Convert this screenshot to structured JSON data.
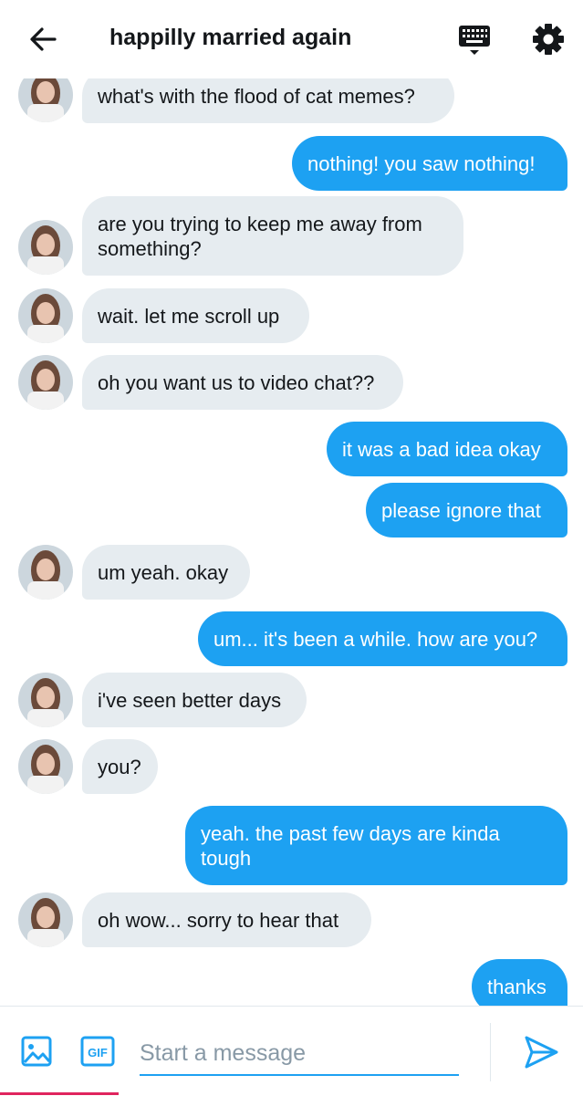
{
  "header": {
    "title": "happilly married again",
    "back_icon": "arrow-left-icon",
    "keyboard_icon": "keyboard-icon",
    "settings_icon": "gear-icon"
  },
  "messages": [
    {
      "from": "them",
      "text": "what's with the flood of cat memes?"
    },
    {
      "from": "me",
      "text": "nothing! you saw nothing!"
    },
    {
      "from": "them",
      "text": "are you trying to keep me away from something?"
    },
    {
      "from": "them",
      "text": "wait. let me scroll up"
    },
    {
      "from": "them",
      "text": "oh you want us to video chat??"
    },
    {
      "from": "me",
      "text": "it was a bad idea okay"
    },
    {
      "from": "me",
      "text": "please ignore that"
    },
    {
      "from": "them",
      "text": "um yeah. okay"
    },
    {
      "from": "me",
      "text": "um... it's been a while. how are you?"
    },
    {
      "from": "them",
      "text": "i've seen better days"
    },
    {
      "from": "them",
      "text": "you?"
    },
    {
      "from": "me",
      "text": "yeah. the past few days are kinda tough"
    },
    {
      "from": "them",
      "text": "oh wow... sorry to hear that"
    },
    {
      "from": "me",
      "text": "thanks"
    }
  ],
  "composer": {
    "placeholder": "Start a message",
    "gif_label": "GIF",
    "media_icon": "image-icon",
    "send_icon": "send-icon"
  },
  "colors": {
    "accent": "#1da1f2",
    "incoming_bubble": "#e6ecf0",
    "outgoing_text": "#ffffff",
    "text": "#14171a",
    "placeholder": "#8899a6"
  }
}
